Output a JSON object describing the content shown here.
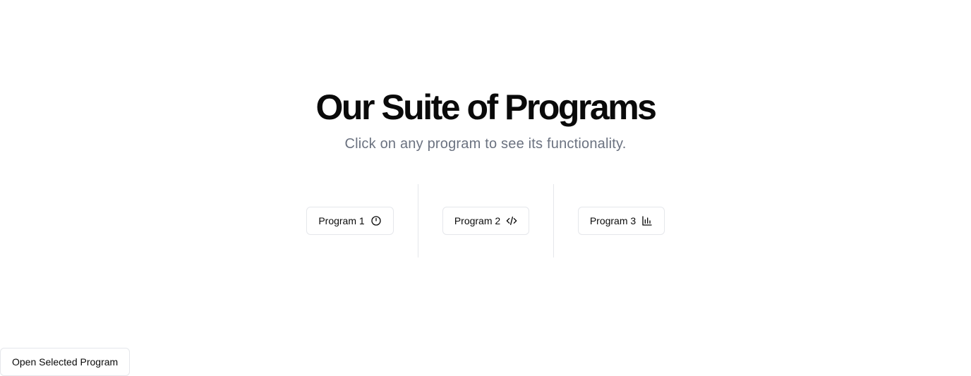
{
  "hero": {
    "title": "Our Suite of Programs",
    "subtitle": "Click on any program to see its functionality."
  },
  "programs": [
    {
      "label": "Program 1",
      "icon": "timer-icon"
    },
    {
      "label": "Program 2",
      "icon": "code-icon"
    },
    {
      "label": "Program 3",
      "icon": "bar-chart-icon"
    }
  ],
  "actions": {
    "open_label": "Open Selected Program"
  },
  "colors": {
    "text": "#0a0a0a",
    "muted": "#6b7280",
    "border": "#e5e7eb",
    "background": "#ffffff"
  }
}
